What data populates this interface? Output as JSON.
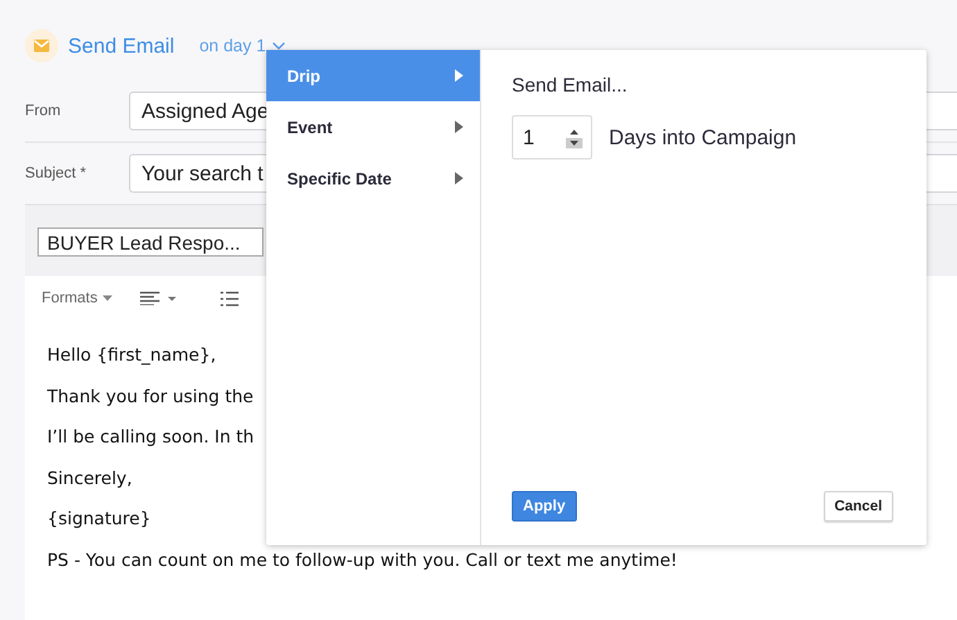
{
  "header": {
    "title": "Send Email",
    "timing": "on day 1"
  },
  "fields": [
    {
      "label": "From",
      "value": "Assigned Age"
    },
    {
      "label": "Subject",
      "required_mark": "*",
      "value": "Your search t"
    }
  ],
  "template": {
    "value": "BUYER Lead Respo..."
  },
  "toolbar": {
    "formats": "Formats"
  },
  "body": [
    "Hello {first_name},",
    "Thank you for using the",
    "I’ll be calling soon. In th",
    "Sincerely,",
    "{signature}",
    "PS - You can count on me to follow-up with you. Call or text me anytime!"
  ],
  "popover": {
    "menu": [
      {
        "label": "Drip",
        "selected": true
      },
      {
        "label": "Event",
        "selected": false
      },
      {
        "label": "Specific Date",
        "selected": false
      }
    ],
    "heading": "Send Email...",
    "days": "1",
    "days_label": "Days into Campaign",
    "apply": "Apply",
    "cancel": "Cancel"
  }
}
